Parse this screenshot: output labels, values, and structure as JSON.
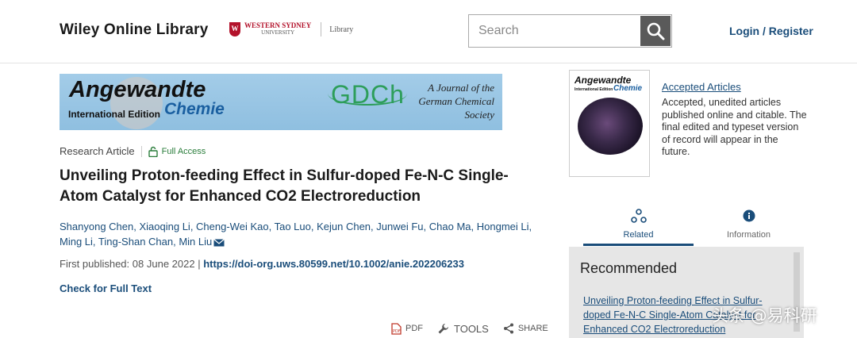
{
  "header": {
    "site_title": "Wiley Online Library",
    "institution_line1": "WESTERN SYDNEY",
    "institution_line2": "UNIVERSITY",
    "institution_library": "Library",
    "search_placeholder": "Search",
    "login_label": "Login / Register"
  },
  "banner": {
    "journal_name": "Angewandte",
    "edition": "International Edition",
    "chemie": "Chemie",
    "society_logo": "GDCh",
    "society_text": "A Journal of the German Chemical Society"
  },
  "article": {
    "type": "Research Article",
    "access": "Full Access",
    "title": "Unveiling Proton-feeding Effect in Sulfur-doped Fe-N-C Single-Atom Catalyst for Enhanced CO2 Electroreduction",
    "authors": [
      "Shanyong Chen",
      "Xiaoqing Li",
      "Cheng-Wei Kao",
      "Tao Luo",
      "Kejun Chen",
      "Junwei Fu",
      "Chao Ma",
      "Hongmei Li",
      "Ming Li",
      "Ting-Shan Chan",
      "Min Liu"
    ],
    "first_published_label": "First published:",
    "first_published_date": "08 June 2022",
    "doi": "https://doi-org.uws.80599.net/10.1002/anie.202206233",
    "check_full_text": "Check for Full Text"
  },
  "toolbar": {
    "pdf": "PDF",
    "tools": "TOOLS",
    "share": "SHARE"
  },
  "sidebar": {
    "cover_title": "Angewandte",
    "cover_chemie": "Chemie",
    "cover_edition": "International Edition",
    "accepted_link": "Accepted Articles",
    "accepted_text": "Accepted, unedited articles published online and citable. The final edited and typeset version of record will appear in the future.",
    "tabs": [
      {
        "label": "Related",
        "icon": "related-icon"
      },
      {
        "label": "Information",
        "icon": "info-icon"
      }
    ],
    "recommended_heading": "Recommended",
    "recommended_link": "Unveiling Proton-feeding Effect in Sulfur-doped Fe-N-C Single-Atom Catalyst for Enhanced CO2 Electroreduction"
  },
  "watermark": "头条 @易科研",
  "colors": {
    "link": "#1a4d7a",
    "access_green": "#2a7d3b",
    "banner_blue": "#a3cce8",
    "institution_red": "#b3122b"
  }
}
